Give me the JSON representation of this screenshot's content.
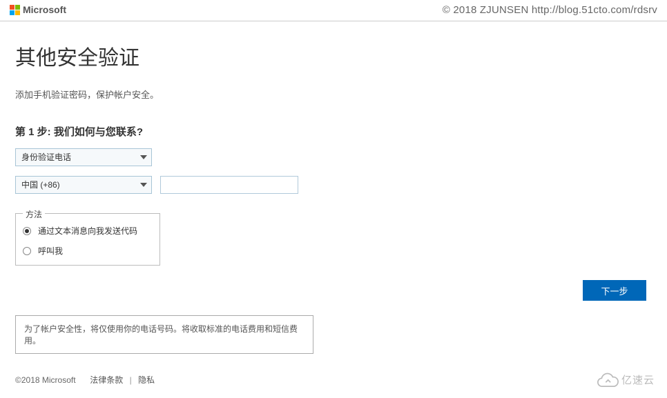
{
  "header": {
    "brand": "Microsoft",
    "watermark": "© 2018 ZJUNSEN http://blog.51cto.com/rdsrv"
  },
  "main": {
    "title": "其他安全验证",
    "subtitle": "添加手机验证密码，保护帐户安全。",
    "step_label": "第 1 步: 我们如何与您联系?",
    "verify_method_selected": "身份验证电话",
    "country_selected": "中国 (+86)",
    "phone_value": "",
    "fieldset_legend": "方法",
    "radio_option_sms": "通过文本消息向我发送代码",
    "radio_option_call": "呼叫我",
    "next_button": "下一步",
    "note": "为了帐户安全性，将仅使用你的电话号码。将收取标准的电话费用和短信费用。"
  },
  "footer": {
    "copyright": "©2018 Microsoft",
    "legal": "法律条款",
    "privacy": "隐私",
    "brand_badge": "亿速云"
  }
}
